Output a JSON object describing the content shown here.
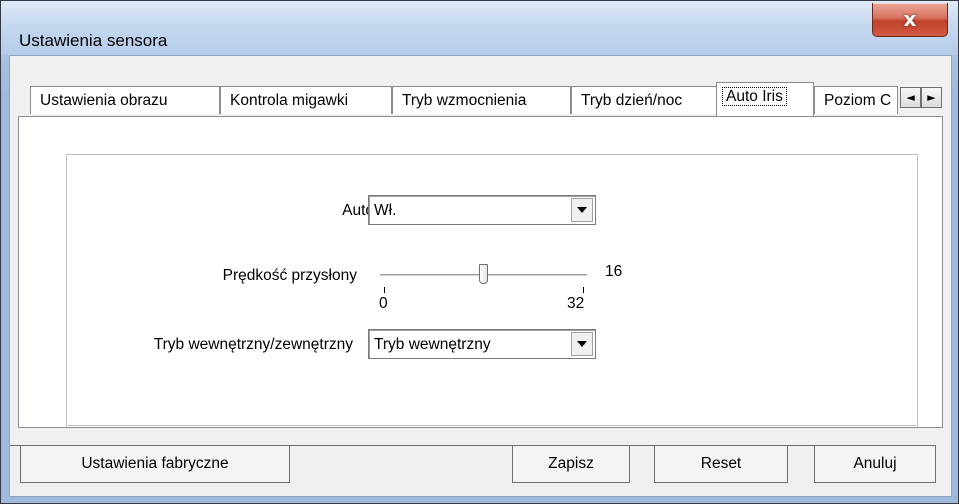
{
  "window": {
    "title": "Ustawienia sensora",
    "close_glyph": "x"
  },
  "tabs": [
    {
      "label": "Ustawienia obrazu"
    },
    {
      "label": "Kontrola migawki"
    },
    {
      "label": "Tryb wzmocnienia"
    },
    {
      "label": "Tryb dzień/noc"
    },
    {
      "label": "Auto Iris",
      "active": true
    },
    {
      "label": "Poziom C"
    }
  ],
  "tab_scroll": {
    "left_glyph": "◄",
    "right_glyph": "►"
  },
  "auto_iris": {
    "label": "Auto Iris",
    "value": "Wł."
  },
  "iris_speed": {
    "label": "Prędkość przysłony",
    "value": 16,
    "value_text": "16",
    "min": 0,
    "max": 32,
    "min_text": "0",
    "max_text": "32"
  },
  "mode": {
    "label": "Tryb wewnętrzny/zewnętrzny",
    "value": "Tryb wewnętrzny"
  },
  "buttons": {
    "factory": "Ustawienia fabryczne",
    "save": "Zapisz",
    "reset": "Reset",
    "cancel": "Anuluj"
  }
}
